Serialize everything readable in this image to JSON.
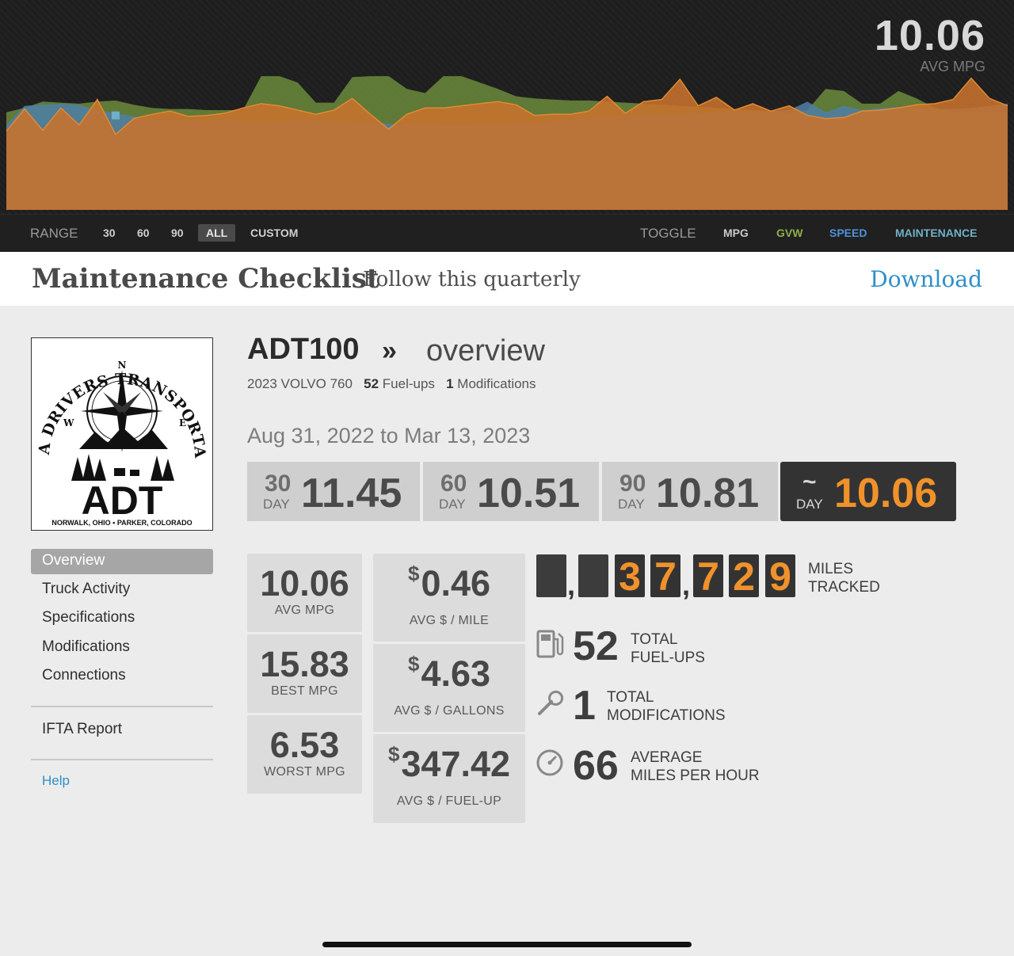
{
  "chart": {
    "avg_value": "10.06",
    "avg_label": "AVG MPG",
    "series": {
      "gvw": {
        "color": "#6b8a3c",
        "values": [
          9.2,
          9.6,
          10.2,
          10.1,
          10.0,
          10.2,
          10.3,
          9.9,
          9.6,
          9.5,
          9.5,
          9.4,
          9.4,
          9.4,
          12.6,
          12.6,
          12.0,
          10.1,
          10.1,
          12.5,
          12.6,
          12.6,
          11.4,
          11.0,
          12.6,
          12.6,
          12.0,
          11.4,
          10.7,
          10.5,
          10.4,
          10.3,
          10.3,
          10.2,
          10.1,
          10.0,
          9.9,
          9.8,
          9.7,
          9.6,
          9.5,
          9.4,
          9.3,
          9.0,
          9.4,
          11.4,
          11.2,
          10.0,
          10.0,
          11.2,
          10.5,
          9.6,
          9.2,
          9.2,
          9.2,
          9.2
        ]
      },
      "speed": {
        "color": "#4f7fa8",
        "values": [
          8.0,
          9.8,
          9.9,
          10.0,
          9.9,
          9.4,
          9.1,
          8.8,
          8.6,
          8.5,
          8.5,
          8.4,
          8.4,
          8.3,
          8.3,
          8.3,
          8.4,
          8.4,
          8.3,
          8.3,
          8.2,
          8.1,
          8.1,
          8.0,
          8.0,
          8.0,
          8.0,
          8.1,
          8.1,
          8.2,
          8.3,
          8.5,
          8.7,
          8.8,
          8.9,
          9.0,
          9.0,
          9.0,
          9.1,
          9.2,
          9.2,
          9.2,
          9.3,
          9.4,
          10.2,
          9.2,
          9.8,
          9.4,
          9.6,
          9.7,
          9.6,
          9.5,
          9.5,
          9.6,
          9.8,
          10.0
        ]
      },
      "mpg": {
        "color": "#c8722c",
        "values": [
          7.4,
          9.5,
          7.5,
          9.6,
          8.0,
          10.4,
          7.1,
          8.6,
          9.0,
          9.3,
          8.8,
          8.9,
          9.1,
          9.6,
          10.0,
          9.8,
          9.4,
          9.0,
          9.4,
          10.5,
          9.0,
          7.6,
          9.0,
          9.6,
          9.6,
          9.8,
          10.0,
          10.2,
          9.9,
          8.9,
          9.0,
          9.0,
          9.3,
          10.7,
          9.1,
          10.2,
          10.4,
          12.3,
          9.8,
          10.6,
          9.4,
          10.0,
          9.3,
          9.8,
          8.9,
          8.6,
          8.7,
          9.3,
          9.4,
          9.6,
          9.9,
          10.0,
          10.4,
          12.4,
          10.5,
          9.8
        ]
      },
      "mpg_line": {
        "color": "#e08a34"
      }
    },
    "maintenance_marker": {
      "index": 6,
      "value": 8.9
    }
  },
  "range_bar": {
    "range_label": "RANGE",
    "options": [
      "30",
      "60",
      "90",
      "ALL",
      "CUSTOM"
    ],
    "toggle_label": "TOGGLE",
    "toggles": [
      {
        "label": "MPG",
        "color": "#c9c9c9"
      },
      {
        "label": "GVW",
        "color": "#8fae4e"
      },
      {
        "label": "SPEED",
        "color": "#4f91d6"
      },
      {
        "label": "MAINTENANCE",
        "color": "#6fb0c7"
      }
    ]
  },
  "header": {
    "title": "Maintenance Checklist",
    "subtitle": "Follow this quarterly",
    "download": "Download"
  },
  "logo": {
    "arc_text": "ALPHA DRIVERS TRANSPORTATION",
    "monogram": "ADT",
    "compass": {
      "n": "N",
      "w": "W",
      "e": "E"
    },
    "footer": "NORWALK, OHIO • PARKER, COLORADO"
  },
  "sidebar": {
    "items": [
      "Overview",
      "Truck Activity",
      "Specifications",
      "Modifications",
      "Connections"
    ],
    "report": "IFTA Report",
    "help": "Help"
  },
  "truck": {
    "id": "ADT100",
    "arrow": "»",
    "view": "overview",
    "model": "2023 VOLVO 760",
    "fuelups_count": "52",
    "fuelups_label": "Fuel-ups",
    "mods_count": "1",
    "mods_label": "Modifications",
    "date_range": "Aug 31, 2022 to Mar 13, 2023"
  },
  "day_stats": [
    {
      "num": "30",
      "word": "DAY",
      "value": "11.45"
    },
    {
      "num": "60",
      "word": "DAY",
      "value": "10.51"
    },
    {
      "num": "90",
      "word": "DAY",
      "value": "10.81"
    },
    {
      "num": "~",
      "word": "DAY",
      "value": "10.06"
    }
  ],
  "mpg_stats": [
    {
      "value": "10.06",
      "label": "AVG MPG"
    },
    {
      "value": "15.83",
      "label": "BEST MPG"
    },
    {
      "value": "6.53",
      "label": "WORST MPG"
    }
  ],
  "cost_stats": [
    {
      "currency": "$",
      "value": "0.46",
      "label": "AVG $ / MILE"
    },
    {
      "currency": "$",
      "value": "4.63",
      "label": "AVG $ / GALLONS"
    },
    {
      "currency": "$",
      "value": "347.42",
      "label": "AVG $ / FUEL-UP"
    }
  ],
  "odometer": {
    "digits": [
      "3",
      "7",
      "7",
      "2",
      "9"
    ],
    "label_line1": "MILES",
    "label_line2": "TRACKED"
  },
  "totals": [
    {
      "icon": "fuel-pump-icon",
      "value": "52",
      "line1": "TOTAL",
      "line2": "FUEL-UPS"
    },
    {
      "icon": "wrench-icon",
      "value": "1",
      "line1": "TOTAL",
      "line2": "MODIFICATIONS"
    },
    {
      "icon": "speedometer-icon",
      "value": "66",
      "line1": "AVERAGE",
      "line2": "MILES PER HOUR"
    }
  ]
}
